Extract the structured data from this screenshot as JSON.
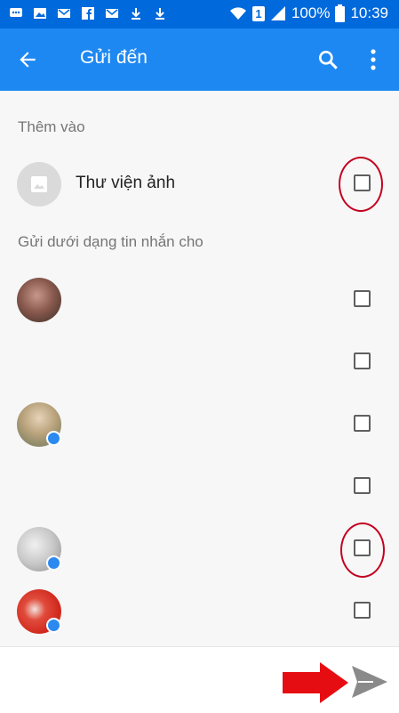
{
  "status_bar": {
    "battery": "100%",
    "time": "10:39",
    "sim_slot": "1",
    "left_icons": [
      "chat-icon",
      "image-icon",
      "gmail-icon",
      "facebook-icon",
      "gmail-icon",
      "download-icon",
      "download-icon"
    ]
  },
  "app_bar": {
    "title": "Gửi đến",
    "back_icon": "arrow-back-icon",
    "search_icon": "search-icon",
    "more_icon": "more-vert-icon",
    "color": "#1e88f2"
  },
  "sections": {
    "add_to": "Thêm vào",
    "send_as_message": "Gửi dưới dạng tin nhắn cho"
  },
  "gallery": {
    "label": "Thư viện ảnh",
    "checked": false
  },
  "contacts": [
    {
      "has_avatar": true,
      "messenger_badge": false,
      "checked": false
    },
    {
      "has_avatar": false,
      "messenger_badge": false,
      "checked": false
    },
    {
      "has_avatar": true,
      "messenger_badge": true,
      "checked": false
    },
    {
      "has_avatar": false,
      "messenger_badge": false,
      "checked": false
    },
    {
      "has_avatar": true,
      "messenger_badge": true,
      "checked": false
    },
    {
      "has_avatar": true,
      "messenger_badge": true,
      "checked": false
    }
  ],
  "bottom": {
    "send_icon": "send-icon",
    "annotation_icon": "red-arrow-icon"
  },
  "annotation_color": "#c4001f"
}
